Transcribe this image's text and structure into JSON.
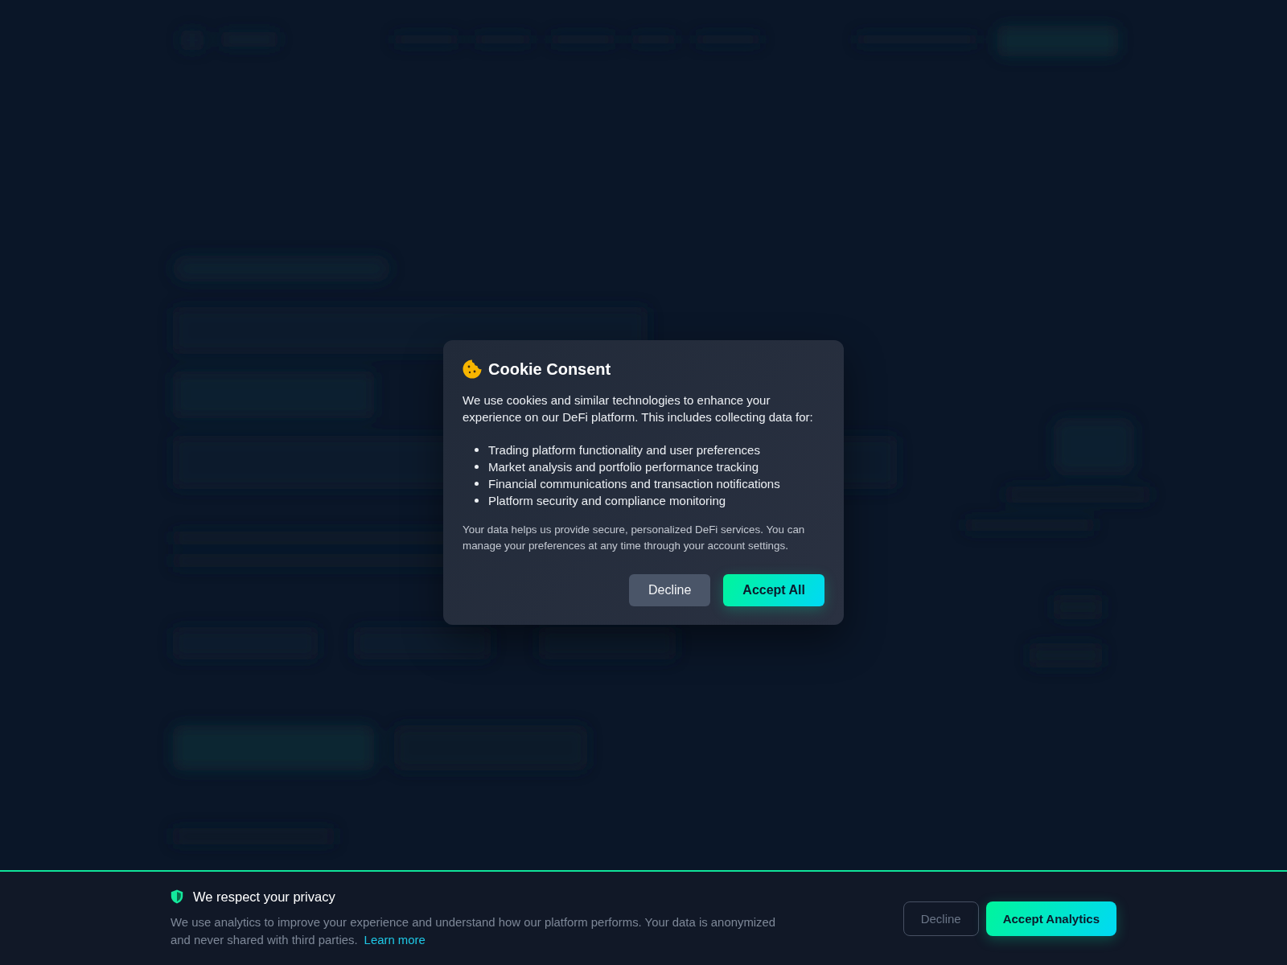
{
  "cookie_dialog": {
    "title": "Cookie Consent",
    "intro": "We use cookies and similar technologies to enhance your experience on our DeFi platform. This includes collecting data for:",
    "purposes": [
      "Trading platform functionality and user preferences",
      "Market analysis and portfolio performance tracking",
      "Financial communications and transaction notifications",
      "Platform security and compliance monitoring"
    ],
    "note": "Your data helps us provide secure, personalized DeFi services. You can manage your preferences at any time through your account settings.",
    "buttons": [
      {
        "label": "Decline",
        "kind": "secondary"
      },
      {
        "label": "Accept All",
        "kind": "primary"
      }
    ]
  },
  "privacy_banner": {
    "title": "We respect your privacy",
    "text": "We use analytics to improve your experience and understand how our platform performs. Your data is anonymized and never shared with third parties.",
    "link": "Learn more",
    "buttons": [
      {
        "label": "Decline",
        "kind": "outline"
      },
      {
        "label": "Accept Analytics",
        "kind": "primary"
      }
    ]
  }
}
